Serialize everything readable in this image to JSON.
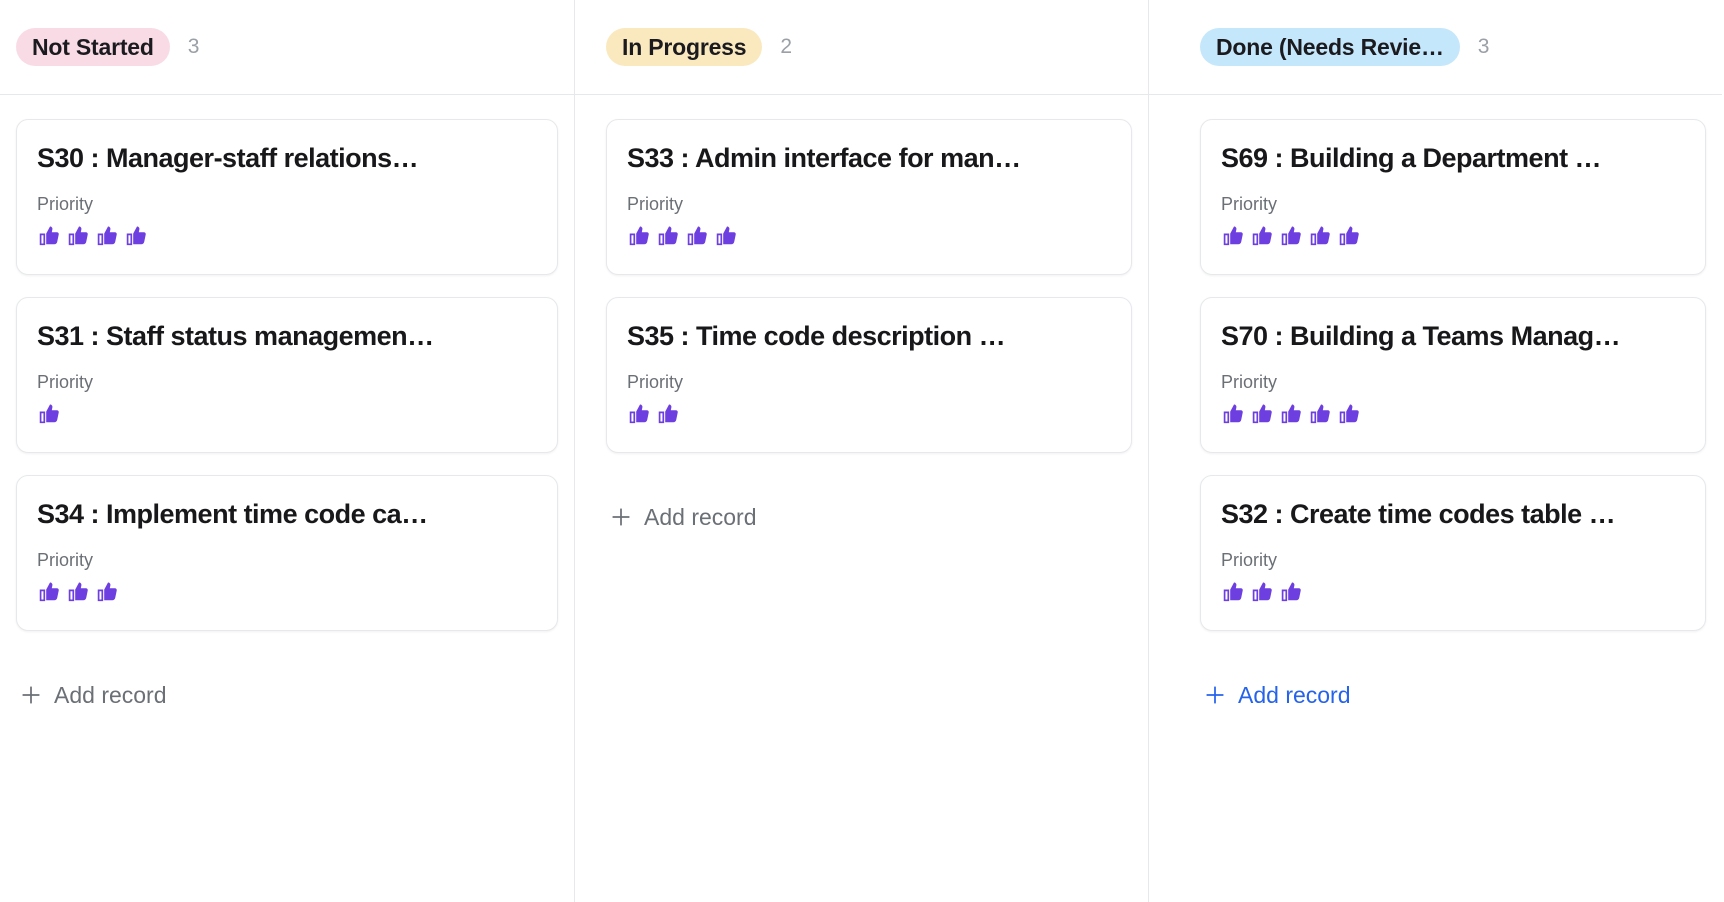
{
  "board": {
    "view_type": "kanban",
    "accent_color": "#2563eb",
    "rating_icon_color": "#6d3fe0",
    "columns": [
      {
        "id": "not-started",
        "status_label": "Not Started",
        "pill_color": "#f9dbe6",
        "count": "3",
        "add_record_label": "Add record",
        "add_record_state": "default",
        "cards": [
          {
            "title": "S30 : Manager-staff relations…",
            "field_label": "Priority",
            "rating": 4
          },
          {
            "title": "S31 : Staff status managemen…",
            "field_label": "Priority",
            "rating": 1
          },
          {
            "title": "S34 : Implement time code ca…",
            "field_label": "Priority",
            "rating": 3
          }
        ]
      },
      {
        "id": "in-progress",
        "status_label": "In Progress",
        "pill_color": "#fae9bf",
        "count": "2",
        "add_record_label": "Add record",
        "add_record_state": "default",
        "cards": [
          {
            "title": "S33 : Admin interface for man…",
            "field_label": "Priority",
            "rating": 4
          },
          {
            "title": "S35 : Time code description …",
            "field_label": "Priority",
            "rating": 2
          }
        ]
      },
      {
        "id": "done-needs-review",
        "status_label": "Done (Needs Revie…",
        "pill_color": "#c5e7fb",
        "count": "3",
        "add_record_label": "Add record",
        "add_record_state": "active",
        "cards": [
          {
            "title": "S69 : Building a Department …",
            "field_label": "Priority",
            "rating": 5
          },
          {
            "title": "S70 : Building a Teams Manag…",
            "field_label": "Priority",
            "rating": 5
          },
          {
            "title": "S32 : Create time codes table …",
            "field_label": "Priority",
            "rating": 3
          }
        ]
      }
    ]
  },
  "icons": {
    "rating": "thumbs-up-icon",
    "add": "plus-icon"
  }
}
